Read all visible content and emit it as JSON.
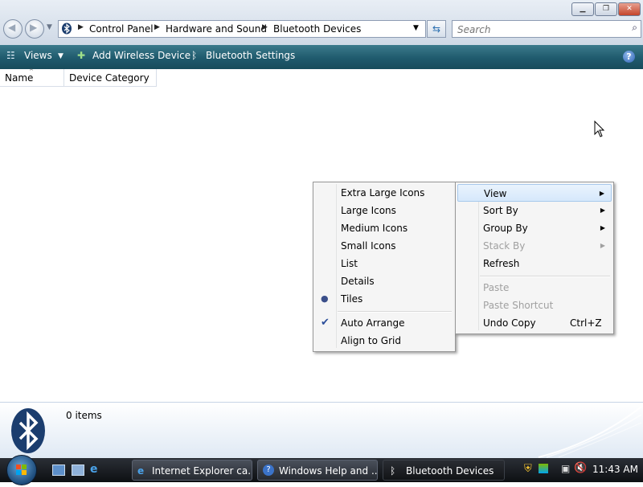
{
  "address": {
    "crumbs": [
      "Control Panel",
      "Hardware and Sound",
      "Bluetooth Devices"
    ]
  },
  "search": {
    "placeholder": "Search"
  },
  "toolbar": {
    "views": "Views",
    "add_wireless": "Add Wireless Device",
    "bluetooth_settings": "Bluetooth Settings"
  },
  "columns": {
    "name": "Name",
    "category": "Device Category"
  },
  "view_submenu": {
    "items": [
      "Extra Large Icons",
      "Large Icons",
      "Medium Icons",
      "Small Icons",
      "List",
      "Details",
      "Tiles",
      "Auto Arrange",
      "Align to Grid"
    ]
  },
  "context_menu": {
    "view": "View",
    "sort_by": "Sort By",
    "group_by": "Group By",
    "stack_by": "Stack By",
    "refresh": "Refresh",
    "paste": "Paste",
    "paste_shortcut": "Paste Shortcut",
    "undo_copy": "Undo Copy",
    "undo_shortcut": "Ctrl+Z"
  },
  "details": {
    "count": "0 items"
  },
  "taskbar": {
    "buttons": [
      "Internet Explorer ca...",
      "Windows Help and ...",
      "Bluetooth Devices"
    ],
    "clock": "11:43 AM"
  },
  "colors": {
    "toolbar": "#1f5a6d",
    "menu_highlight": "#d6e8fb",
    "bluetooth_logo": "#1b3d6e"
  }
}
